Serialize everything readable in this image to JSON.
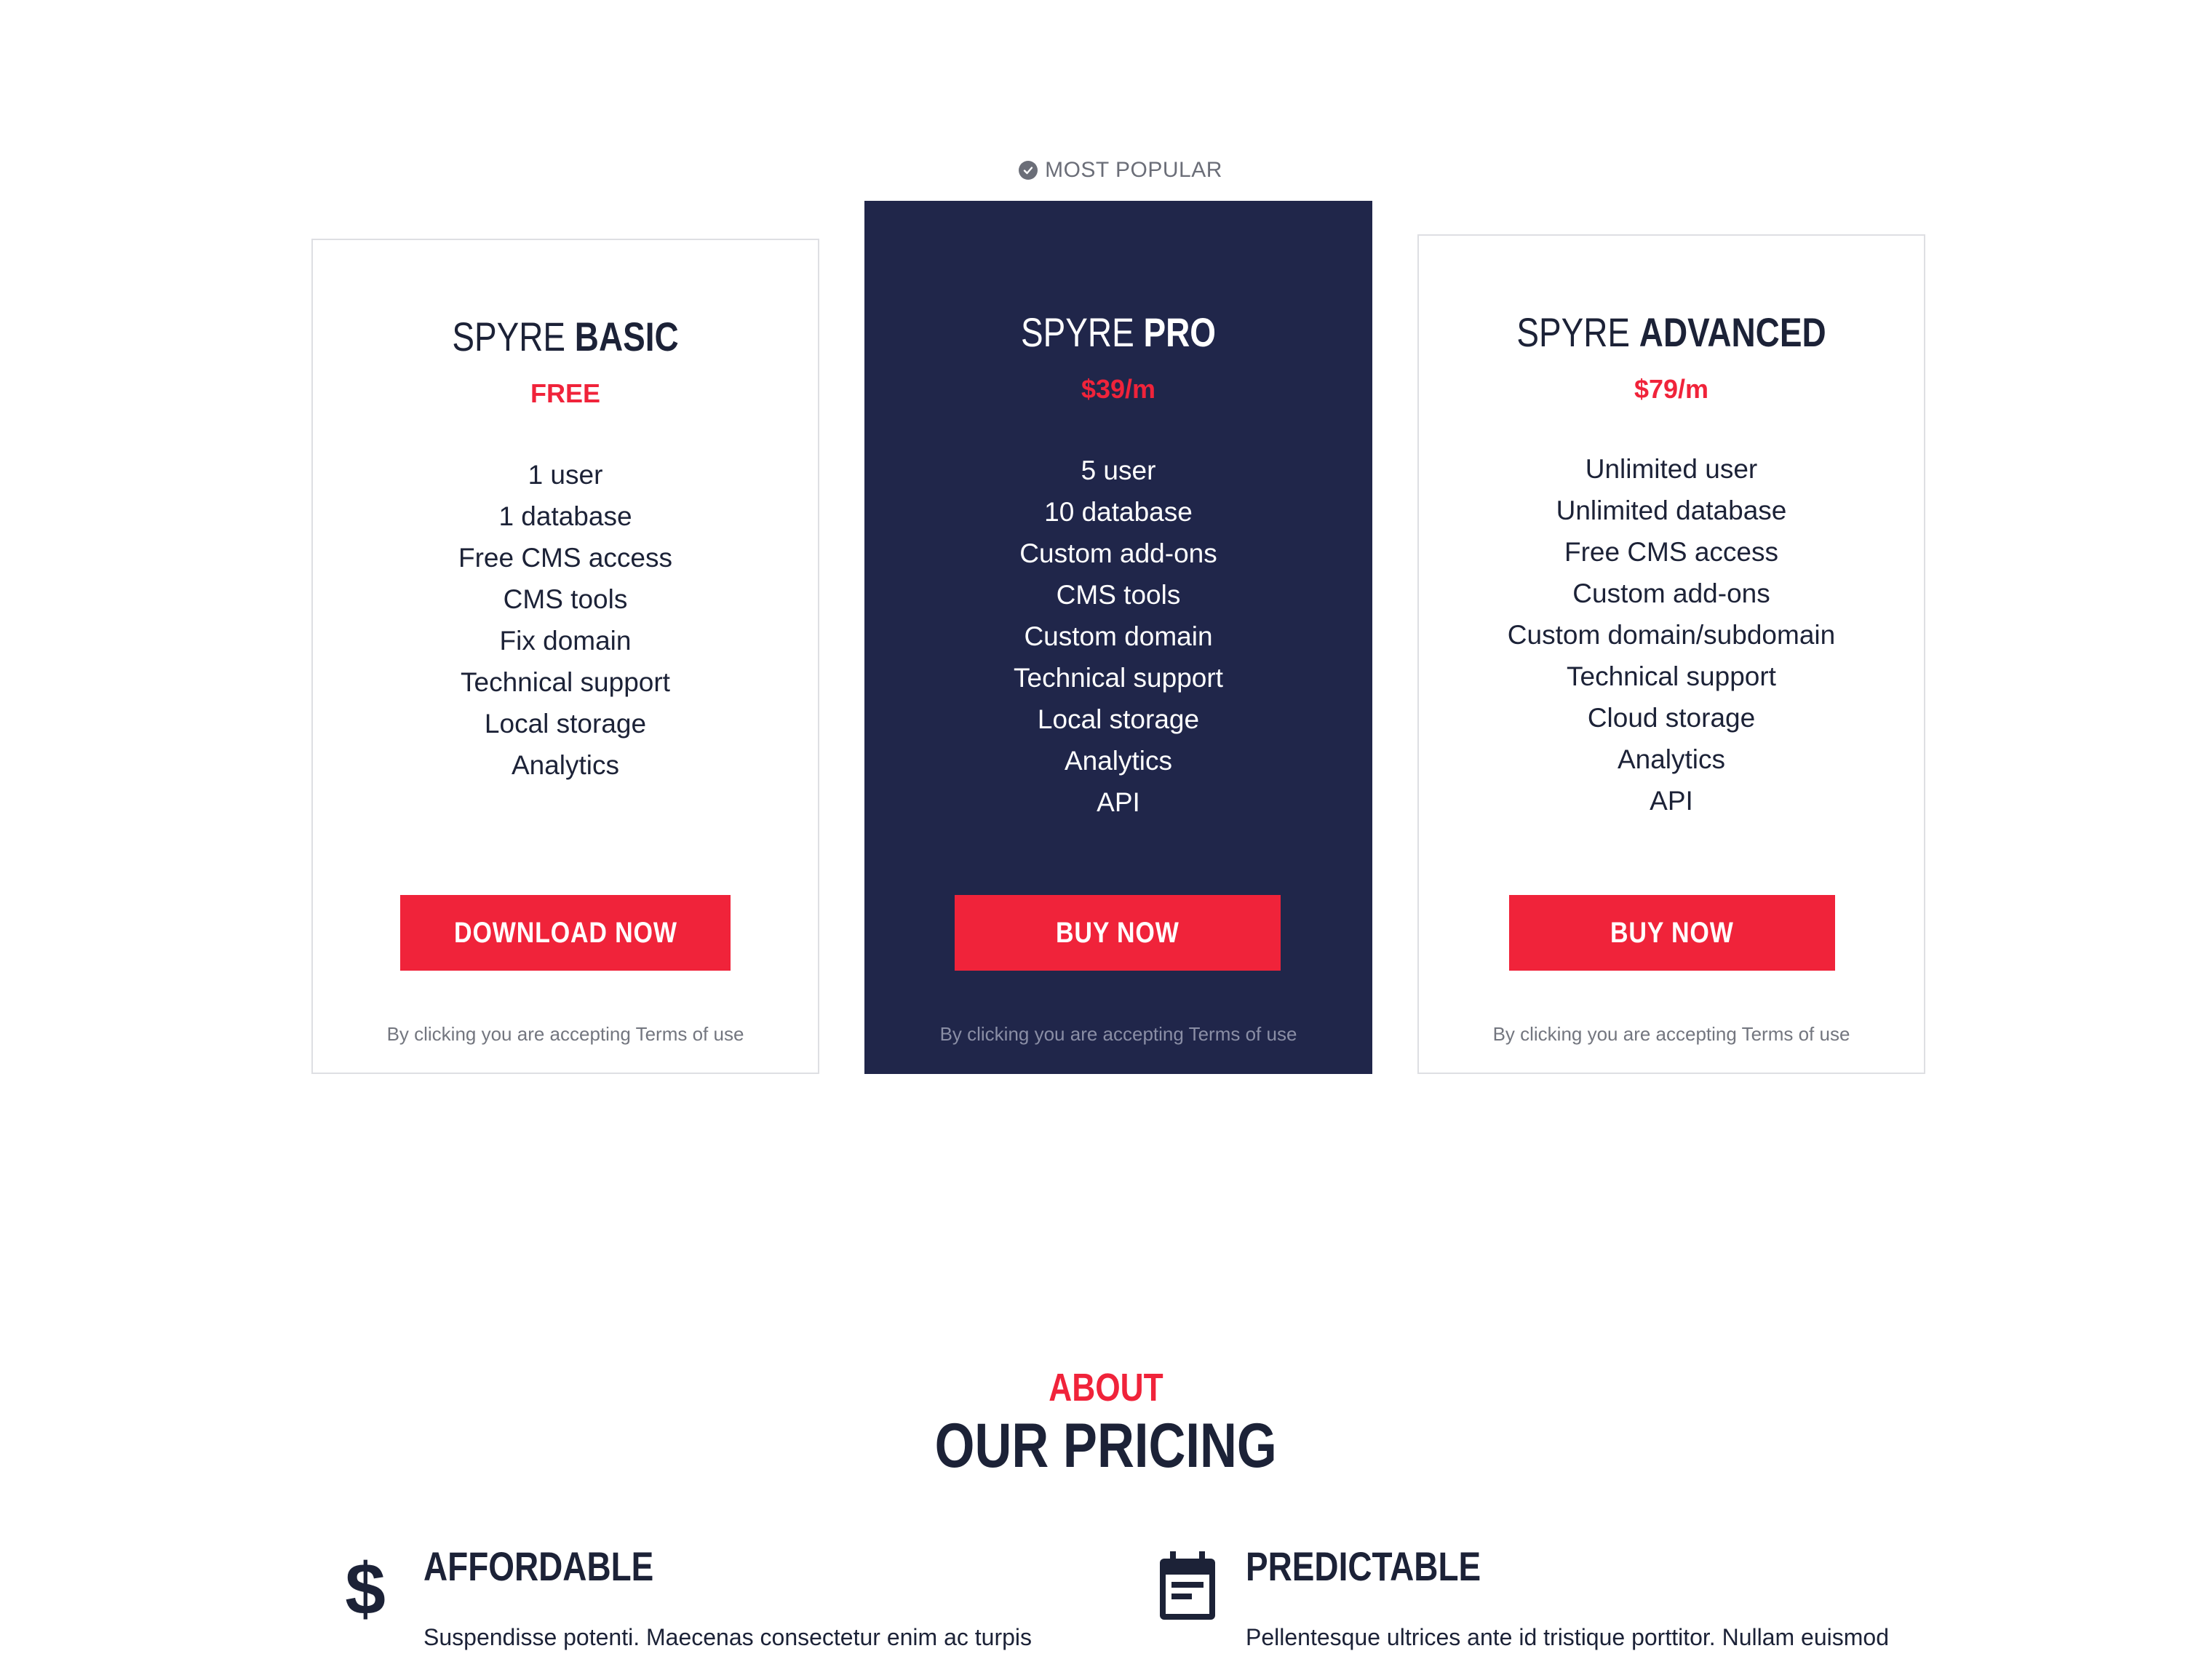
{
  "popular_tag": "MOST POPULAR",
  "plans": [
    {
      "name_prefix": "SPYRE",
      "name_bold": "BASIC",
      "price": "FREE",
      "features": [
        "1 user",
        "1 database",
        "Free CMS access",
        "CMS tools",
        "Fix domain",
        "Technical support",
        "Local storage",
        "Analytics"
      ],
      "cta": "DOWNLOAD NOW",
      "terms": "By clicking you are accepting Terms of use"
    },
    {
      "name_prefix": "SPYRE",
      "name_bold": "PRO",
      "price": "$39/m",
      "features": [
        "5 user",
        "10 database",
        "Custom add-ons",
        "CMS tools",
        "Custom domain",
        "Technical support",
        "Local storage",
        "Analytics",
        "API"
      ],
      "cta": "BUY NOW",
      "terms": "By clicking you are accepting Terms of use"
    },
    {
      "name_prefix": "SPYRE",
      "name_bold": "ADVANCED",
      "price": "$79/m",
      "features": [
        "Unlimited user",
        "Unlimited database",
        "Free CMS access",
        "Custom add-ons",
        "Custom domain/subdomain",
        "Technical support",
        "Cloud storage",
        "Analytics",
        "API"
      ],
      "cta": "BUY NOW",
      "terms": "By clicking you are accepting Terms of use"
    }
  ],
  "about": {
    "kicker": "ABOUT",
    "title": "OUR PRICING",
    "features": [
      {
        "icon": "dollar-icon",
        "title": "AFFORDABLE",
        "text": "Suspendisse potenti. Maecenas consectetur enim ac turpis"
      },
      {
        "icon": "calendar-icon",
        "title": "PREDICTABLE",
        "text": "Pellentesque ultrices ante id tristique porttitor. Nullam euismod"
      }
    ]
  },
  "colors": {
    "accent": "#f0233a",
    "navy": "#20264a",
    "text": "#1c2237",
    "muted": "#73767f"
  }
}
